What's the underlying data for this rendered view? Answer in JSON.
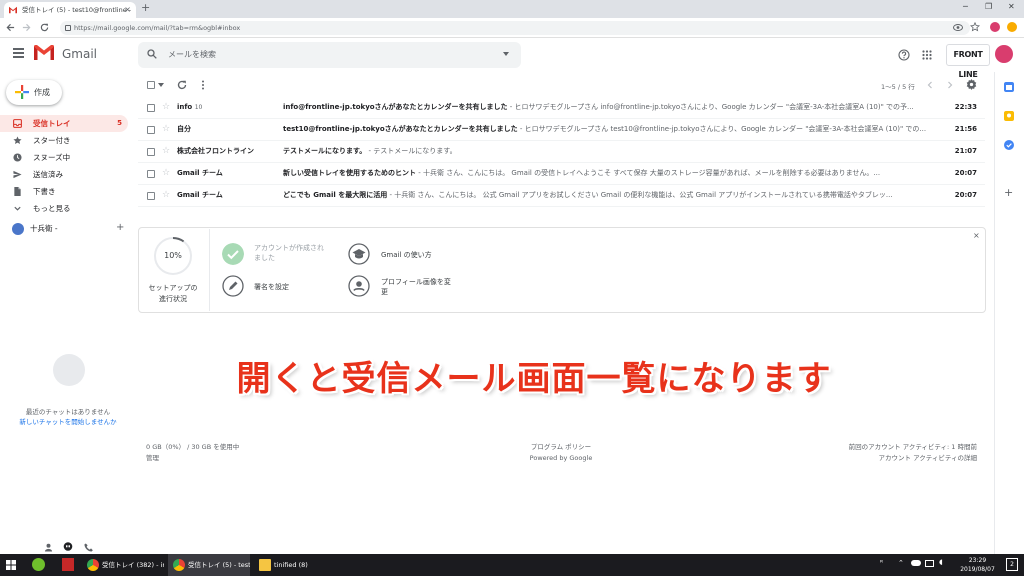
{
  "browser": {
    "tab_title": "受信トレイ (5) - test10@frontline -",
    "tab_close": "×",
    "new_tab": "+",
    "url": "https://mail.google.com/mail/?tab=rm&ogbl#inbox",
    "win_min": "─",
    "win_max": "❐",
    "win_close": "✕"
  },
  "gmail": {
    "logo_text": "Gmail",
    "search_placeholder": "メールを検索",
    "brand_logo": "FRONT LINE",
    "compose_label": "作成",
    "nav": [
      {
        "label": "受信トレイ",
        "count": "5"
      },
      {
        "label": "スター付き"
      },
      {
        "label": "スヌーズ中"
      },
      {
        "label": "送信済み"
      },
      {
        "label": "下書き"
      },
      {
        "label": "もっと見る"
      }
    ],
    "user_label": "十兵衛 -",
    "hangout_add": "+",
    "chat_empty": "最近のチャットはありません",
    "chat_start": "新しいチャットを開始しませんか",
    "pager": "1～5 / 5 行",
    "mails": [
      {
        "sender": "info",
        "sender_count": "10",
        "subject": "info@frontline-jp.tokyoさんがあなたとカレンダーを共有しました",
        "snippet": " - ヒロサワデモグループさん info@frontline-jp.tokyoさんにより、Google カレンダー \"会議室-3A-本社会議室A (10)\" での予...",
        "time": "22:33"
      },
      {
        "sender": "自分",
        "sender_count": "",
        "subject": "test10@frontline-jp.tokyoさんがあなたとカレンダーを共有しました",
        "snippet": " - ヒロサワデモグループさん test10@frontline-jp.tokyoさんにより、Google カレンダー \"会議室-3A-本社会議室A (10)\" での...",
        "time": "21:56"
      },
      {
        "sender": "株式会社フロントライン",
        "sender_count": "",
        "subject": "テストメールになります。",
        "snippet": " - テストメールになります。",
        "time": "21:07"
      },
      {
        "sender": "Gmail チーム",
        "sender_count": "",
        "subject": "新しい受信トレイを使用するためのヒント",
        "snippet": " - 十兵衛 さん、こんにちは。 Gmail の受信トレイへようこそ すべて保存 大量のストレージ容量があれば、メールを削除する必要はありません。...",
        "time": "20:07"
      },
      {
        "sender": "Gmail チーム",
        "sender_count": "",
        "subject": "どこでも Gmail を最大限に活用",
        "snippet": " - 十兵衛 さん、こんにちは。 公式 Gmail アプリをお試しください Gmail の便利な機能は、公式 Gmail アプリがインストールされている携帯電話やタブレッ...",
        "time": "20:07"
      }
    ],
    "setup": {
      "percent": "10%",
      "progress": 0.1,
      "label_line1": "セットアップの",
      "label_line2": "進行状況",
      "task_done_l1": "アカウントが作成され",
      "task_done_l2": "ました",
      "task_signature": "署名を設定",
      "task_howto": "Gmail の使い方",
      "task_profile_l1": "プロフィール画像を変",
      "task_profile_l2": "更",
      "close": "×"
    },
    "overlay_text": "開くと受信メール画面一覧になります",
    "footer": {
      "storage": "0 GB（0%） / 30 GB を使用中",
      "manage": "管理",
      "policy": "プログラム ポリシー",
      "powered": "Powered by Google",
      "activity": "前回のアカウント アクティビティ: 1 時間前",
      "details": "アカウント アクティビティの詳細"
    }
  },
  "taskbar": {
    "items": [
      "受信トレイ (382) - in...",
      "受信トレイ (5) - test1...",
      "tinified (8)"
    ],
    "time": "23:29",
    "date": "2019/08/07",
    "notif": "2"
  }
}
